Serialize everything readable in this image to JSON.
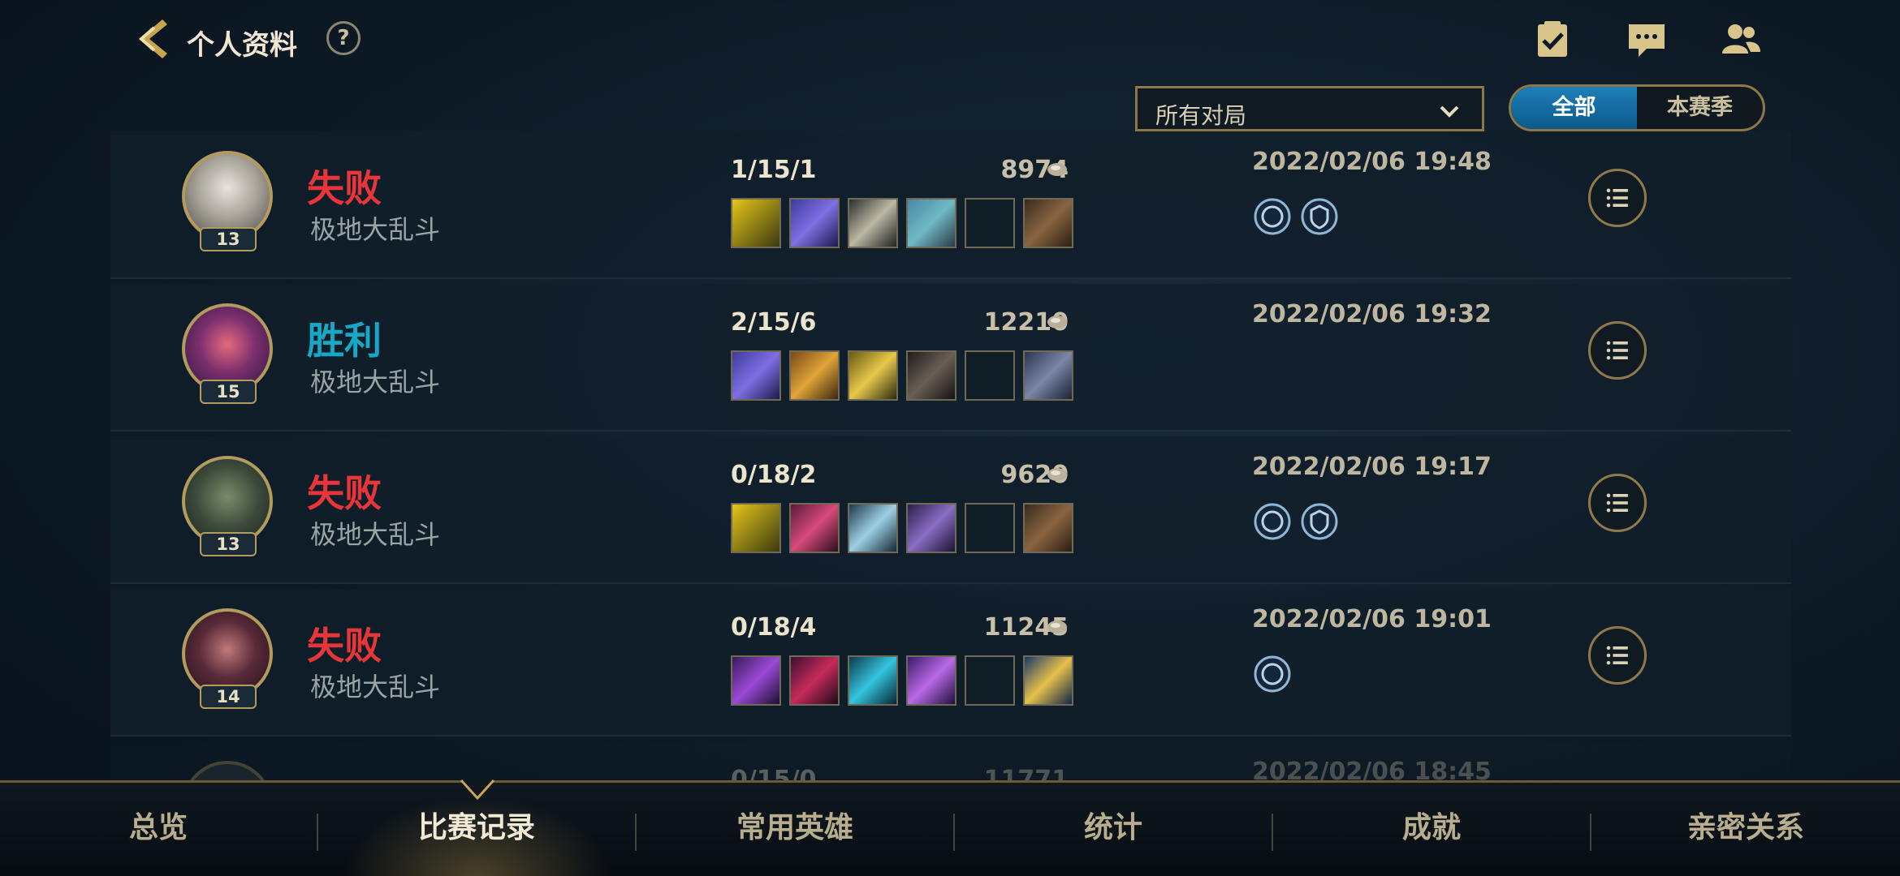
{
  "header": {
    "title": "个人资料",
    "help_label": "?",
    "icons": [
      "checklist-icon",
      "chat-icon",
      "friends-icon"
    ]
  },
  "filters": {
    "game_filter_value": "所有对局",
    "season_toggle": {
      "all_label": "全部",
      "season_label": "本赛季",
      "selected": "全部"
    }
  },
  "matches": [
    {
      "result": "失败",
      "result_type": "loss",
      "mode": "极地大乱斗",
      "level": "13",
      "kda": "1/15/1",
      "gold": "8974",
      "date": "2022/02/06 19:48",
      "badges": 2
    },
    {
      "result": "胜利",
      "result_type": "win",
      "mode": "极地大乱斗",
      "level": "15",
      "kda": "2/15/6",
      "gold": "12210",
      "date": "2022/02/06 19:32",
      "badges": 0
    },
    {
      "result": "失败",
      "result_type": "loss",
      "mode": "极地大乱斗",
      "level": "13",
      "kda": "0/18/2",
      "gold": "9620",
      "date": "2022/02/06 19:17",
      "badges": 2
    },
    {
      "result": "失败",
      "result_type": "loss",
      "mode": "极地大乱斗",
      "level": "14",
      "kda": "0/18/4",
      "gold": "11245",
      "date": "2022/02/06 19:01",
      "badges": 1
    },
    {
      "result": "",
      "result_type": "loss",
      "mode": "",
      "level": "",
      "kda": "0/15/0",
      "gold": "11771",
      "date": "2022/02/06 18:45",
      "badges": 0
    }
  ],
  "bottom_nav": {
    "tabs": [
      "总览",
      "比赛记录",
      "常用英雄",
      "统计",
      "成就",
      "亲密关系"
    ],
    "active": "比赛记录"
  },
  "colors": {
    "loss": "#e8353a",
    "win": "#16a9c7",
    "gold_border": "#8e7746",
    "active_tab_blue": "#1d7fb8"
  }
}
